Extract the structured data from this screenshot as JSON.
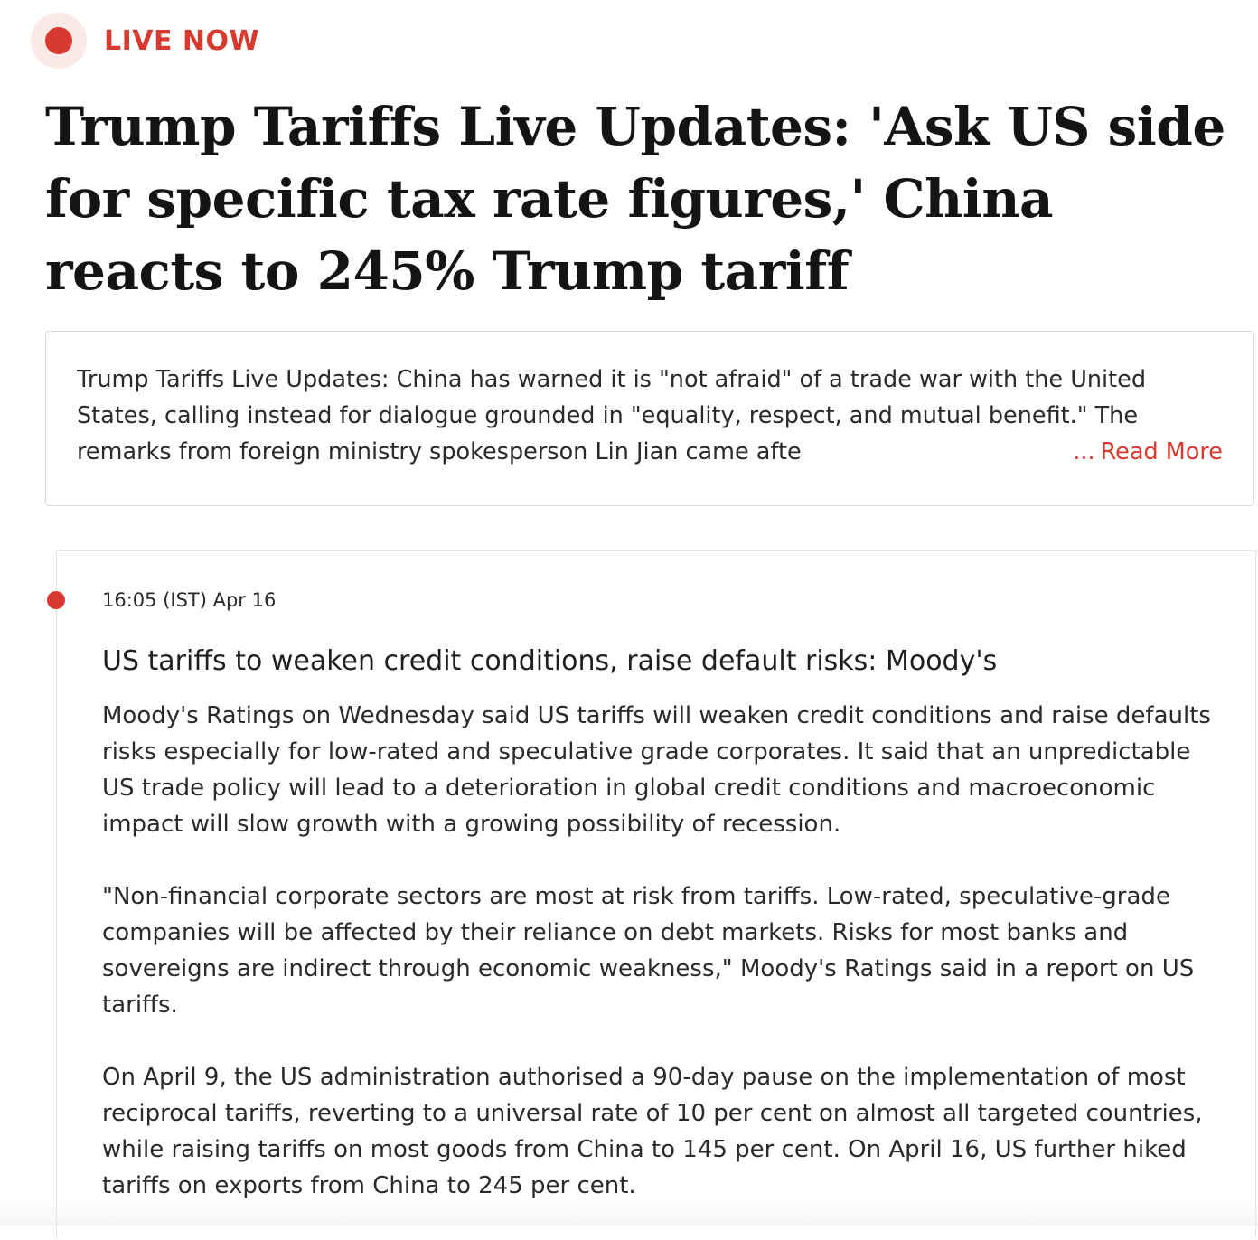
{
  "live_badge": {
    "label": "LIVE NOW"
  },
  "article": {
    "headline": "Trump Tariffs Live Updates: 'Ask US side for specific tax rate figures,' China reacts to 245% Trump tariff",
    "summary": "Trump Tariffs Live Updates: China has warned it is \"not afraid\" of a trade war with the United States, calling instead for dialogue grounded in \"equality, respect, and mutual benefit.\" The remarks from foreign ministry spokesperson Lin Jian came afte",
    "read_more_ellipsis": "...",
    "read_more_label": "Read More"
  },
  "timeline": {
    "entries": [
      {
        "timestamp": "16:05 (IST) Apr 16",
        "title": "US tariffs to weaken credit conditions, raise default risks: Moody's",
        "paragraphs": [
          "Moody's Ratings on Wednesday said US tariffs will weaken credit conditions and raise defaults risks especially for low-rated and speculative grade corporates. It said that an unpredictable US trade policy will lead to a deterioration in global credit conditions and macroeconomic impact will slow growth with a growing possibility of recession.",
          "\"Non-financial corporate sectors are most at risk from tariffs. Low-rated, speculative-grade companies will be affected by their reliance on debt markets. Risks for most banks and sovereigns are indirect through economic weakness,\" Moody's Ratings said in a report on US tariffs.",
          "On April 9, the US administration authorised a 90-day pause on the implementation of most reciprocal tariffs, reverting to a universal rate of 10 per cent on almost all targeted countries, while raising tariffs on most goods from China to 145 per cent. On April 16, US further hiked tariffs on exports from China to 245 per cent."
        ]
      }
    ]
  },
  "colors": {
    "accent_red": "#d93a30",
    "live_dot_halo": "#fbe9e8",
    "text_dark": "#141414",
    "border": "#dcdcdc"
  }
}
